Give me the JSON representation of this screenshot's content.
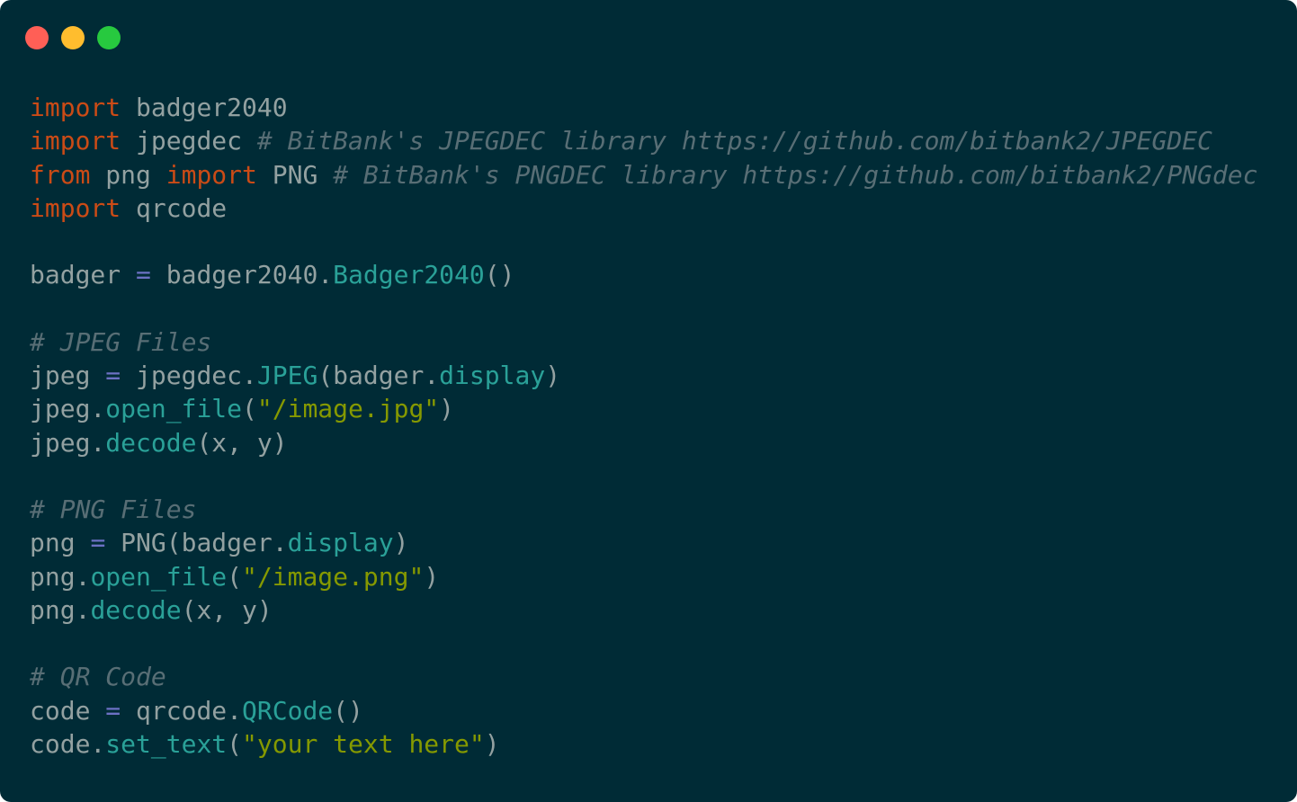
{
  "window": {
    "controls": [
      {
        "name": "close",
        "color": "#ff5f56"
      },
      {
        "name": "minimize",
        "color": "#ffbd2e"
      },
      {
        "name": "maximize",
        "color": "#27c93f"
      }
    ]
  },
  "colors": {
    "background": "#002b36",
    "text": "#93a1a1",
    "keyword": "#cb4b16",
    "comment": "#586e75",
    "operator": "#6c71c4",
    "function": "#2aa198",
    "string": "#859900"
  },
  "code": {
    "lines": [
      [
        {
          "t": "import",
          "k": "keyword"
        },
        {
          "t": " badger2040",
          "k": "text"
        }
      ],
      [
        {
          "t": "import",
          "k": "keyword"
        },
        {
          "t": " jpegdec ",
          "k": "text"
        },
        {
          "t": "# BitBank's JPEGDEC library https://github.com/bitbank2/JPEGDEC",
          "k": "comment"
        }
      ],
      [
        {
          "t": "from",
          "k": "keyword"
        },
        {
          "t": " png ",
          "k": "text"
        },
        {
          "t": "import",
          "k": "keyword"
        },
        {
          "t": " PNG ",
          "k": "text"
        },
        {
          "t": "# BitBank's PNGDEC library https://github.com/bitbank2/PNGdec",
          "k": "comment"
        }
      ],
      [
        {
          "t": "import",
          "k": "keyword"
        },
        {
          "t": " qrcode",
          "k": "text"
        }
      ],
      [],
      [
        {
          "t": "badger ",
          "k": "text"
        },
        {
          "t": "=",
          "k": "operator"
        },
        {
          "t": " badger2040.",
          "k": "text"
        },
        {
          "t": "Badger2040",
          "k": "function"
        },
        {
          "t": "()",
          "k": "text"
        }
      ],
      [],
      [
        {
          "t": "# JPEG Files",
          "k": "comment"
        }
      ],
      [
        {
          "t": "jpeg ",
          "k": "text"
        },
        {
          "t": "=",
          "k": "operator"
        },
        {
          "t": " jpegdec.",
          "k": "text"
        },
        {
          "t": "JPEG",
          "k": "function"
        },
        {
          "t": "(badger.",
          "k": "text"
        },
        {
          "t": "display",
          "k": "function"
        },
        {
          "t": ")",
          "k": "text"
        }
      ],
      [
        {
          "t": "jpeg.",
          "k": "text"
        },
        {
          "t": "open_file",
          "k": "function"
        },
        {
          "t": "(",
          "k": "text"
        },
        {
          "t": "\"/image.jpg\"",
          "k": "string"
        },
        {
          "t": ")",
          "k": "text"
        }
      ],
      [
        {
          "t": "jpeg.",
          "k": "text"
        },
        {
          "t": "decode",
          "k": "function"
        },
        {
          "t": "(x, y)",
          "k": "text"
        }
      ],
      [],
      [
        {
          "t": "# PNG Files",
          "k": "comment"
        }
      ],
      [
        {
          "t": "png ",
          "k": "text"
        },
        {
          "t": "=",
          "k": "operator"
        },
        {
          "t": " PNG(badger.",
          "k": "text"
        },
        {
          "t": "display",
          "k": "function"
        },
        {
          "t": ")",
          "k": "text"
        }
      ],
      [
        {
          "t": "png.",
          "k": "text"
        },
        {
          "t": "open_file",
          "k": "function"
        },
        {
          "t": "(",
          "k": "text"
        },
        {
          "t": "\"/image.png\"",
          "k": "string"
        },
        {
          "t": ")",
          "k": "text"
        }
      ],
      [
        {
          "t": "png.",
          "k": "text"
        },
        {
          "t": "decode",
          "k": "function"
        },
        {
          "t": "(x, y)",
          "k": "text"
        }
      ],
      [],
      [
        {
          "t": "# QR Code",
          "k": "comment"
        }
      ],
      [
        {
          "t": "code ",
          "k": "text"
        },
        {
          "t": "=",
          "k": "operator"
        },
        {
          "t": " qrcode.",
          "k": "text"
        },
        {
          "t": "QRCode",
          "k": "function"
        },
        {
          "t": "()",
          "k": "text"
        }
      ],
      [
        {
          "t": "code.",
          "k": "text"
        },
        {
          "t": "set_text",
          "k": "function"
        },
        {
          "t": "(",
          "k": "text"
        },
        {
          "t": "\"your text here\"",
          "k": "string"
        },
        {
          "t": ")",
          "k": "text"
        }
      ]
    ]
  }
}
